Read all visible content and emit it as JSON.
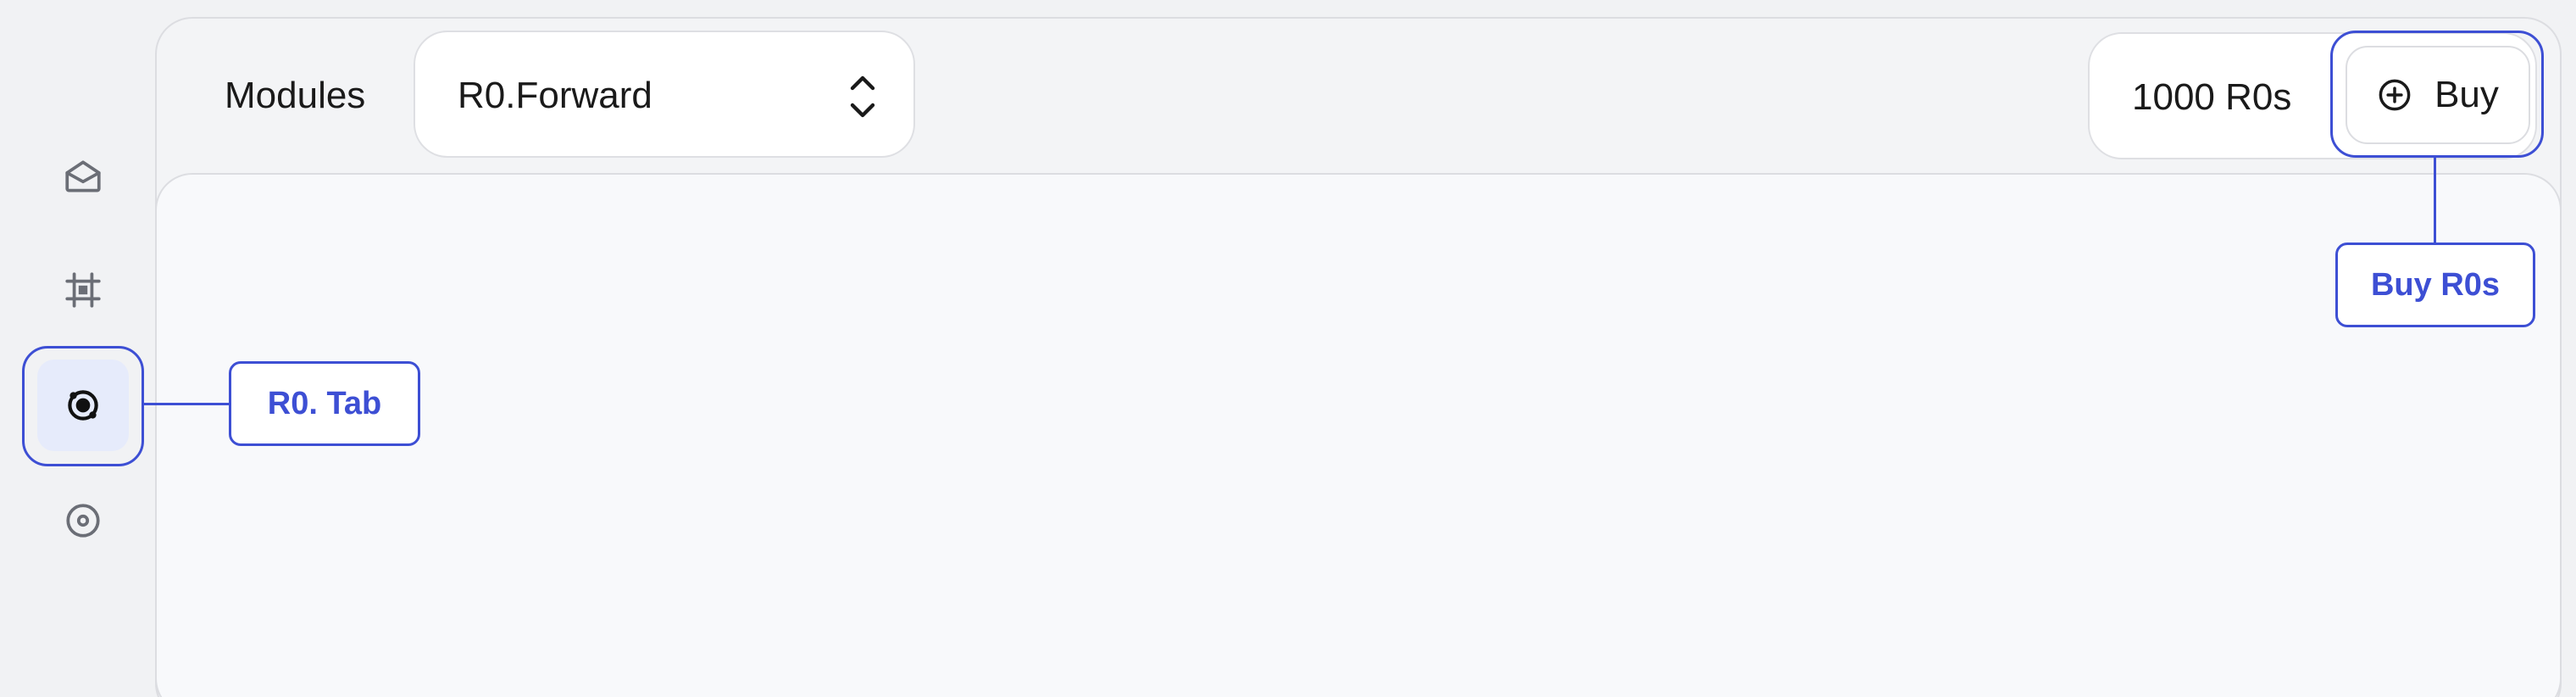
{
  "sidebar": {
    "items": [
      {
        "name": "inbox",
        "icon": "mail-open-icon"
      },
      {
        "name": "modules",
        "icon": "frame-icon"
      },
      {
        "name": "r0",
        "icon": "orbit-icon",
        "active": true
      },
      {
        "name": "view",
        "icon": "eye-icon"
      }
    ]
  },
  "header": {
    "modules_label": "Modules",
    "module_select_value": "R0.Forward",
    "balance": "1000 R0s",
    "buy_label": "Buy"
  },
  "annotations": {
    "tab_callout": "R0. Tab",
    "buy_callout": "Buy R0s"
  },
  "colors": {
    "accent": "#3d4fd4",
    "active_bg": "#e6ebfb",
    "panel_bg": "#f3f4f6",
    "content_bg": "#f8f9fb"
  }
}
